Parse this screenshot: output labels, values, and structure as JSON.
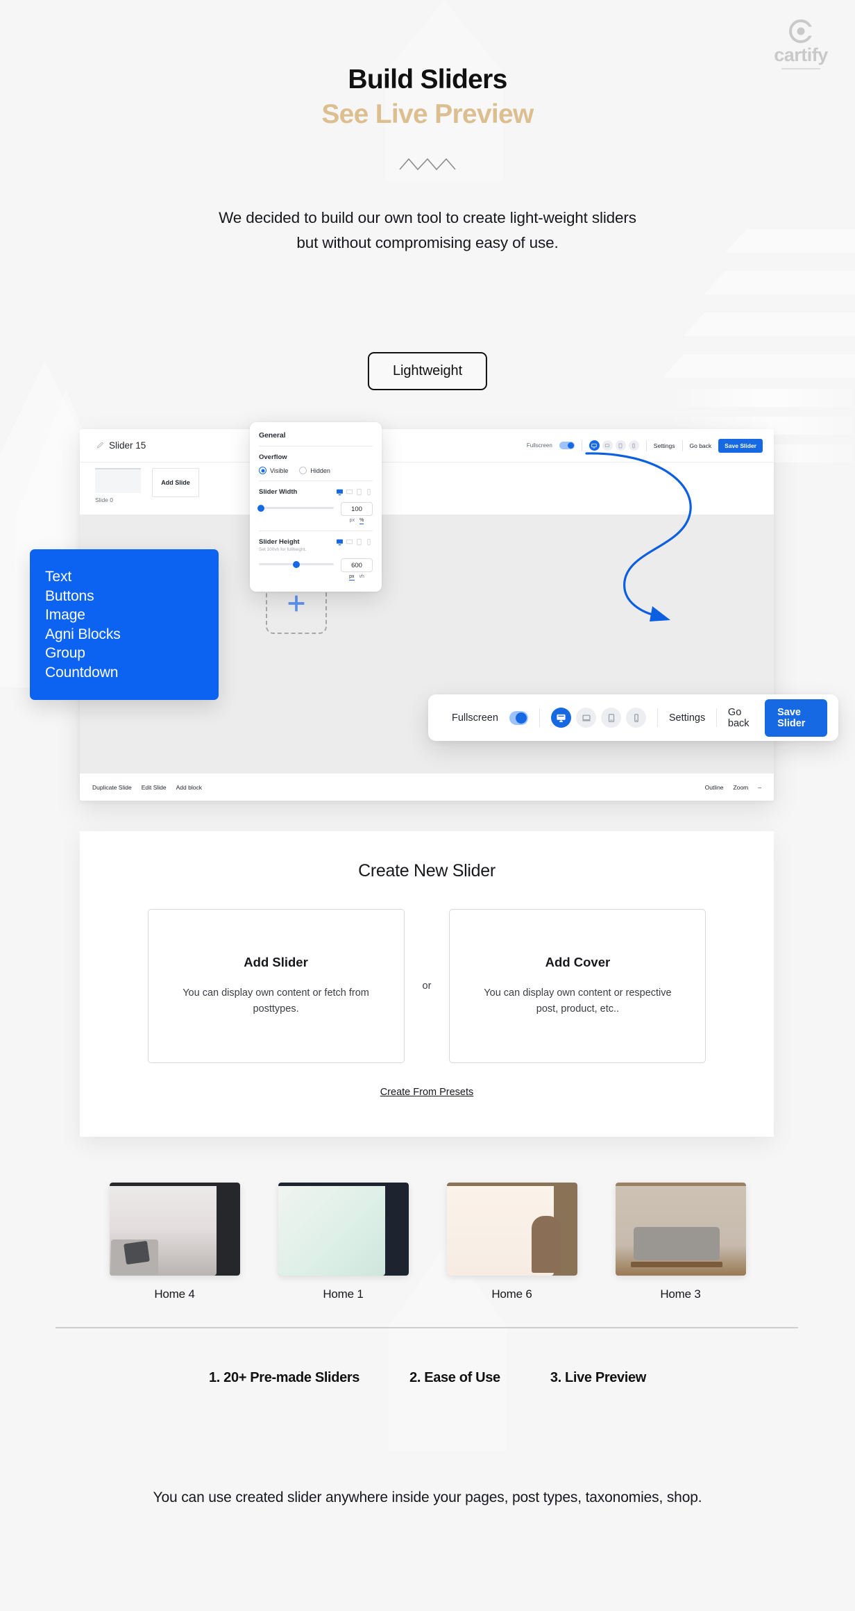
{
  "brand": {
    "logo_text": "cartify",
    "logo_icon": "cartify-circle-c-icon",
    "accent_blue": "#1668e3",
    "accent_gold": "#dcbf90",
    "panel_blue": "#0c63f2"
  },
  "hero": {
    "title": "Build Sliders",
    "subtitle": "See Live Preview",
    "lede": "We decided to build our own tool to create light-weight sliders but without compromising easy of use.",
    "badge": "Lightweight"
  },
  "app": {
    "slider_title": "Slider 15",
    "edit_icon": "pencil-icon",
    "slide_caption": "Slide 0",
    "add_slide_label": "Add Slide",
    "toolbar": {
      "fullscreen_label": "Fullscreen",
      "fullscreen_on": true,
      "devices": [
        "desktop-icon",
        "laptop-icon",
        "tablet-icon",
        "mobile-icon"
      ],
      "active_device": "desktop-icon",
      "settings_label": "Settings",
      "go_back_label": "Go back",
      "save_label": "Save Slider"
    },
    "bottom_bar": {
      "duplicate_slide": "Duplicate Slide",
      "edit_slide": "Edit Slide",
      "add_block": "Add block",
      "outline": "Outline",
      "zoom": "Zoom",
      "zoom_caret": "–"
    },
    "canvas_add_icon": "plus-icon"
  },
  "general_panel": {
    "title": "General",
    "overflow_label": "Overflow",
    "overflow_options": [
      "Visible",
      "Hidden"
    ],
    "overflow_selected": "Visible",
    "slider_width": {
      "label": "Slider Width",
      "value": "100",
      "units": [
        "px",
        "%"
      ],
      "unit_selected": "%",
      "knob_pct": 3
    },
    "slider_height": {
      "label": "Slider Height",
      "hint": "Set 100vh for fullheight.",
      "value": "600",
      "units": [
        "px",
        "vh"
      ],
      "unit_selected": "px",
      "knob_pct": 50
    },
    "device_icons": [
      "desktop-icon",
      "laptop-icon",
      "tablet-icon",
      "mobile-icon"
    ]
  },
  "blocks_panel": {
    "items": [
      "Text",
      "Buttons",
      "Image",
      "Agni Blocks",
      "Group",
      "Countdown"
    ]
  },
  "create_new_slider": {
    "heading": "Create New Slider",
    "or_label": "or",
    "cards": [
      {
        "title": "Add Slider",
        "description": "You can display own content or fetch from posttypes."
      },
      {
        "title": "Add Cover",
        "description": "You can display own content or respective post, product, etc.."
      }
    ],
    "presets_link": "Create From Presets"
  },
  "thumbnails": [
    {
      "label": "Home 4",
      "frame_color": "#26272b",
      "inner_color": "#ded9d7"
    },
    {
      "label": "Home 1",
      "frame_color": "#1d2430",
      "inner_color": "#dfeee7"
    },
    {
      "label": "Home 6",
      "frame_color": "#8a7257",
      "inner_color": "#f6ece3"
    },
    {
      "label": "Home 3",
      "frame_color": "#9a8164",
      "inner_color": "#cdc2b4"
    }
  ],
  "features": [
    "1. 20+ Pre-made Sliders",
    "2. Ease of Use",
    "3. Live Preview"
  ],
  "footer": {
    "text": "You can use created slider anywhere inside your pages, post types, taxonomies, shop."
  }
}
